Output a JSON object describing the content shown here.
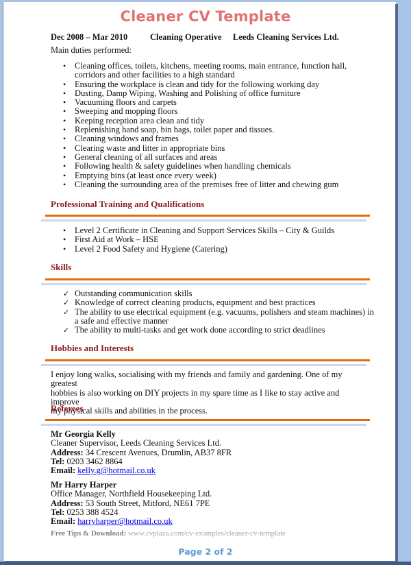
{
  "title": "Cleaner CV Template",
  "employment": {
    "dates": "Dec 2008 – Mar 2010",
    "role": "Cleaning Operative",
    "employer": "Leeds Cleaning Services Ltd.",
    "duties_intro": "Main duties performed:",
    "duties": [
      "Cleaning offices, toilets, kitchens, meeting rooms, main entrance, function hall,",
      "corridors and other facilities to a high standard",
      "Ensuring the workplace is clean and tidy for the following working day",
      "Dusting, Damp Wiping, Washing and Polishing of office furniture",
      "Vacuuming floors and carpets",
      "Sweeping and mopping floors",
      "Keeping reception area clean and tidy",
      "Replenishing hand soap, bin bags, toilet paper and tissues.",
      "Cleaning windows and frames",
      "Clearing waste and litter in appropriate bins",
      "General cleaning of all surfaces and areas",
      "Following health & safety guidelines when handling chemicals",
      "Emptying bins (at least once every week)",
      "Cleaning the surrounding area of the premises free of litter and chewing gum"
    ]
  },
  "training": {
    "heading": "Professional Training and Qualifications",
    "items": [
      "Level 2 Certificate in Cleaning and Support Services Skills – City & Guilds",
      "First Aid at Work – HSE",
      "Level 2 Food Safety and Hygiene (Catering)"
    ]
  },
  "skills": {
    "heading": "Skills",
    "bullet_icon": "checkmark-icon",
    "items": [
      "Outstanding communication skills",
      "Knowledge of correct cleaning products, equipment and best practices",
      "The ability to use electrical equipment (e.g. vacuums, polishers and steam machines) in",
      "a safe and effective manner",
      "The ability to multi-tasks and get work done according to strict deadlines"
    ]
  },
  "hobbies": {
    "heading": "Hobbies and Interests",
    "lines": [
      "I enjoy long walks, socialising with my friends and family and gardening. One of my greatest",
      "hobbies is also working on DIY projects in my spare time as I like to stay active and improve",
      "my physical skills and abilities in the process."
    ]
  },
  "referees": {
    "heading": "Referees",
    "address_label": "Address:",
    "tel_label": "Tel:",
    "email_label": "Email:",
    "people": [
      {
        "name": "Mr Georgia Kelly",
        "position": "Cleaner Supervisor, Leeds Cleaning Services Ltd.",
        "address": "34 Crescent Avenues, Drumlin, AB37 8FR",
        "tel": "0203 3462 8864",
        "email": "kelly.g@hotmail.co.uk"
      },
      {
        "name": "Mr Harry Harper",
        "position": "Office Manager, Northfield Housekeeping Ltd.",
        "address": "53 South Street, Mitford, NE61 7PE",
        "tel": "0253 388 4524",
        "email": "harryharper@hotmail.co.uk"
      }
    ]
  },
  "footer": {
    "tips_label": "Free Tips & Download:",
    "tips_url": "www.cvplaza.com/cv-examples/cleaner-cv-template",
    "page_indicator": "Page 2 of 2"
  },
  "colors": {
    "title": "#e07375",
    "section_heading": "#8b1a1a",
    "rule_orange": "#e46c0a",
    "rule_blue": "#c6d9f1",
    "page_number": "#5b9bd5",
    "link": "#0000ee"
  }
}
